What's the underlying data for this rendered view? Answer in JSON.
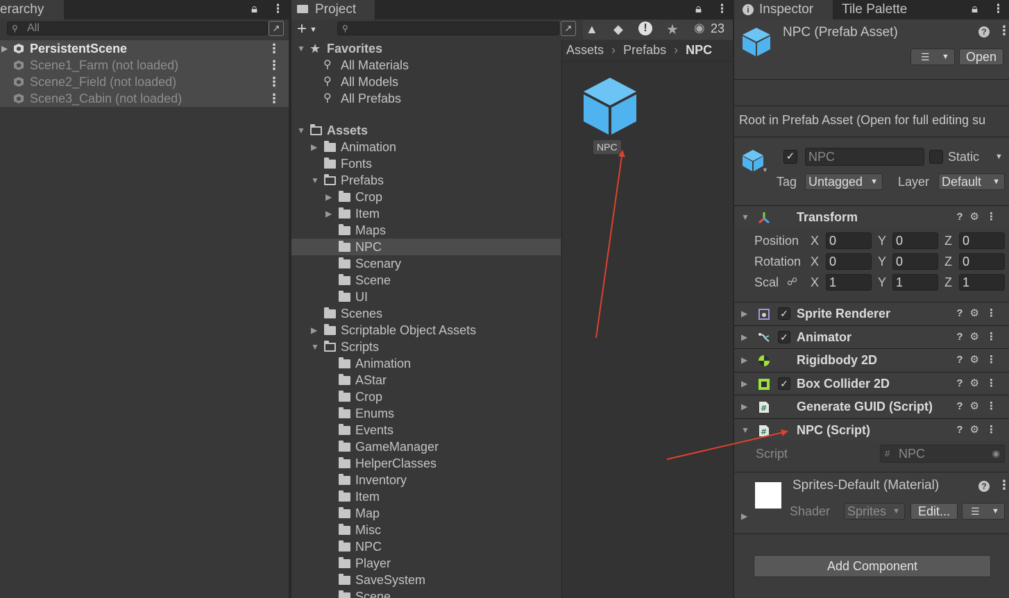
{
  "hierarchy": {
    "tab_label": "erarchy",
    "search_placeholder": "All",
    "scenes": [
      {
        "label": "PersistentScene",
        "loaded": true
      },
      {
        "label": "Scene1_Farm (not loaded)",
        "loaded": false
      },
      {
        "label": "Scene2_Field (not loaded)",
        "loaded": false
      },
      {
        "label": "Scene3_Cabin (not loaded)",
        "loaded": false
      }
    ]
  },
  "project": {
    "tab_label": "Project",
    "add_label": "+",
    "hidden_count": "23",
    "breadcrumb": [
      "Assets",
      "Prefabs",
      "NPC"
    ],
    "favorites": {
      "label": "Favorites",
      "items": [
        "All Materials",
        "All Models",
        "All Prefabs"
      ]
    },
    "assets_root": "Assets",
    "tree": {
      "animation": "Animation",
      "fonts": "Fonts",
      "prefabs": "Prefabs",
      "crop": "Crop",
      "item": "Item",
      "maps": "Maps",
      "npc": "NPC",
      "scenary": "Scenary",
      "scene": "Scene",
      "ui": "UI",
      "scenes": "Scenes",
      "scriptable": "Scriptable Object Assets",
      "scripts": "Scripts",
      "s_animation": "Animation",
      "s_astar": "AStar",
      "s_crop": "Crop",
      "s_enums": "Enums",
      "s_events": "Events",
      "s_gamemanager": "GameManager",
      "s_helper": "HelperClasses",
      "s_inventory": "Inventory",
      "s_item": "Item",
      "s_map": "Map",
      "s_misc": "Misc",
      "s_npc": "NPC",
      "s_player": "Player",
      "s_save": "SaveSystem",
      "s_scene": "Scene"
    },
    "asset_label": "NPC",
    "colors": {
      "prefab_blue": "#4fb3f0",
      "annotation_red": "#e0412e"
    }
  },
  "inspector": {
    "tab_label": "Inspector",
    "tab2_label": "Tile Palette",
    "asset_title": "NPC (Prefab Asset)",
    "open_label": "Open",
    "root_notice": "Root in Prefab Asset (Open for full editing su",
    "object_name": "NPC",
    "static_label": "Static",
    "tag_label": "Tag",
    "tag_value": "Untagged",
    "layer_label": "Layer",
    "layer_value": "Default",
    "transform": {
      "title": "Transform",
      "position_label": "Position",
      "rotation_label": "Rotation",
      "scale_label": "Scal",
      "axes": [
        "X",
        "Y",
        "Z"
      ],
      "position": [
        "0",
        "0",
        "0"
      ],
      "rotation": [
        "0",
        "0",
        "0"
      ],
      "scale": [
        "1",
        "1",
        "1"
      ]
    },
    "components": {
      "sprite_renderer": "Sprite Renderer",
      "animator": "Animator",
      "rigidbody": "Rigidbody 2D",
      "box_collider": "Box Collider 2D",
      "generate_guid": "Generate GUID (Script)",
      "npc_script": "NPC (Script)"
    },
    "script_label": "Script",
    "script_value": "NPC",
    "material_title": "Sprites-Default (Material)",
    "shader_label": "Shader",
    "shader_value": "Sprites",
    "edit_label": "Edit...",
    "add_component_label": "Add Component"
  }
}
